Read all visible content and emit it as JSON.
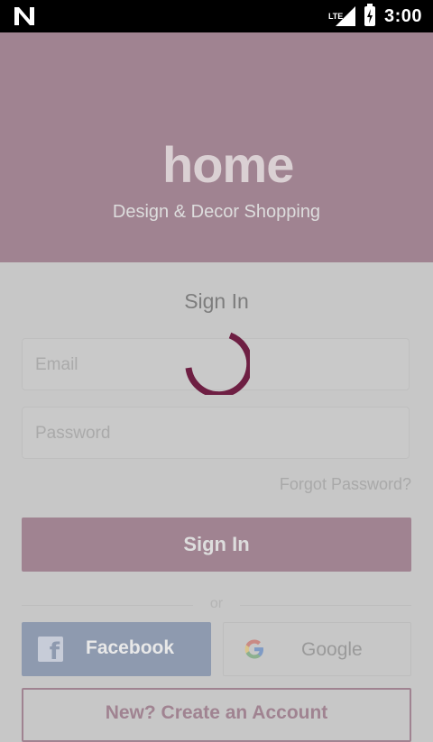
{
  "status_bar": {
    "time": "3:00",
    "network": "LTE"
  },
  "header": {
    "logo_text": "home",
    "tagline": "Design & Decor Shopping"
  },
  "form": {
    "title": "Sign In",
    "email_placeholder": "Email",
    "password_placeholder": "Password",
    "forgot_password": "Forgot Password?",
    "sign_in_button": "Sign In"
  },
  "divider": {
    "text": "or"
  },
  "social": {
    "facebook": "Facebook",
    "google": "Google"
  },
  "create_account": "New? Create an Account",
  "colors": {
    "brand": "#6e1f43",
    "overlay": "#c7c7c7",
    "header": "#a08391"
  }
}
